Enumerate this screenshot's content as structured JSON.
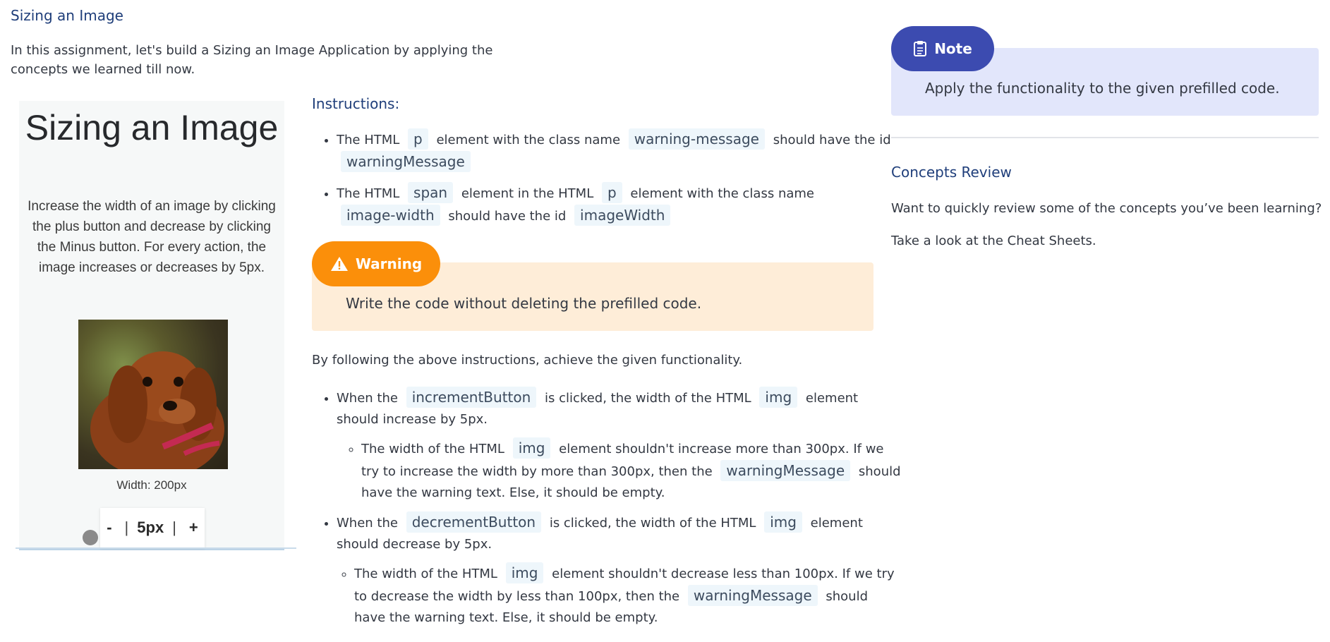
{
  "header": {
    "title": "Sizing an Image",
    "intro": "In this assignment, let's build a Sizing an Image Application by applying the concepts we learned till now."
  },
  "preview": {
    "heading": "Sizing an Image",
    "description": "Increase the width of an image by clicking the plus button and decrease by clicking the Minus button. For every action, the image increases or decreases by 5px.",
    "width_text": "Width: 200px",
    "minus_label": "-",
    "step_label": "5px",
    "plus_label": "+",
    "separator": "|"
  },
  "instructions": {
    "title": "Instructions:",
    "item1": {
      "t1": "The HTML",
      "c1": "p",
      "t2": "element with the class name",
      "c2": "warning-message",
      "t3": "should have the id",
      "c3": "warningMessage"
    },
    "item2": {
      "t1": "The HTML",
      "c1": "span",
      "t2": "element in the HTML",
      "c2": "p",
      "t3": "element with the class name",
      "c3": "image-width",
      "t4": "should have the id",
      "c4": "imageWidth"
    }
  },
  "warning": {
    "label": "Warning",
    "text": "Write the code without deleting the prefilled code."
  },
  "functionality": {
    "intro": "By following the above instructions, achieve the given functionality.",
    "increment": {
      "t1": "When the",
      "c1": "incrementButton",
      "t2": "is clicked, the width of the HTML",
      "c2": "img",
      "t3": "element should increase by 5px.",
      "sub": {
        "t1": "The width of the HTML",
        "c1": "img",
        "t2": "element shouldn't increase more than 300px. If we try to increase the width by more than 300px, then the",
        "c2": "warningMessage",
        "t3": "should have the warning text. Else, it should be empty."
      }
    },
    "decrement": {
      "t1": "When the",
      "c1": "decrementButton",
      "t2": "is clicked, the width of the HTML",
      "c2": "img",
      "t3": "element should decrease by 5px.",
      "sub": {
        "t1": "The width of the HTML",
        "c1": "img",
        "t2": "element shouldn't decrease less than 100px. If we try to decrease the width by less than 100px, then the",
        "c2": "warningMessage",
        "t3": "should have the warning text. Else, it should be empty."
      }
    }
  },
  "note": {
    "label": "Note",
    "text": "Apply the functionality to the given prefilled code."
  },
  "concepts": {
    "title": "Concepts Review",
    "p1": "Want to quickly review some of the concepts you’ve been learning?",
    "p2": "Take a look at the Cheat Sheets."
  },
  "colors": {
    "warning_orange": "#fb8f0a",
    "note_blue": "#3c4bb0",
    "heading_blue": "#1f3e7a"
  },
  "icons": {
    "warning": "warning-triangle-icon",
    "note": "clipboard-icon"
  }
}
